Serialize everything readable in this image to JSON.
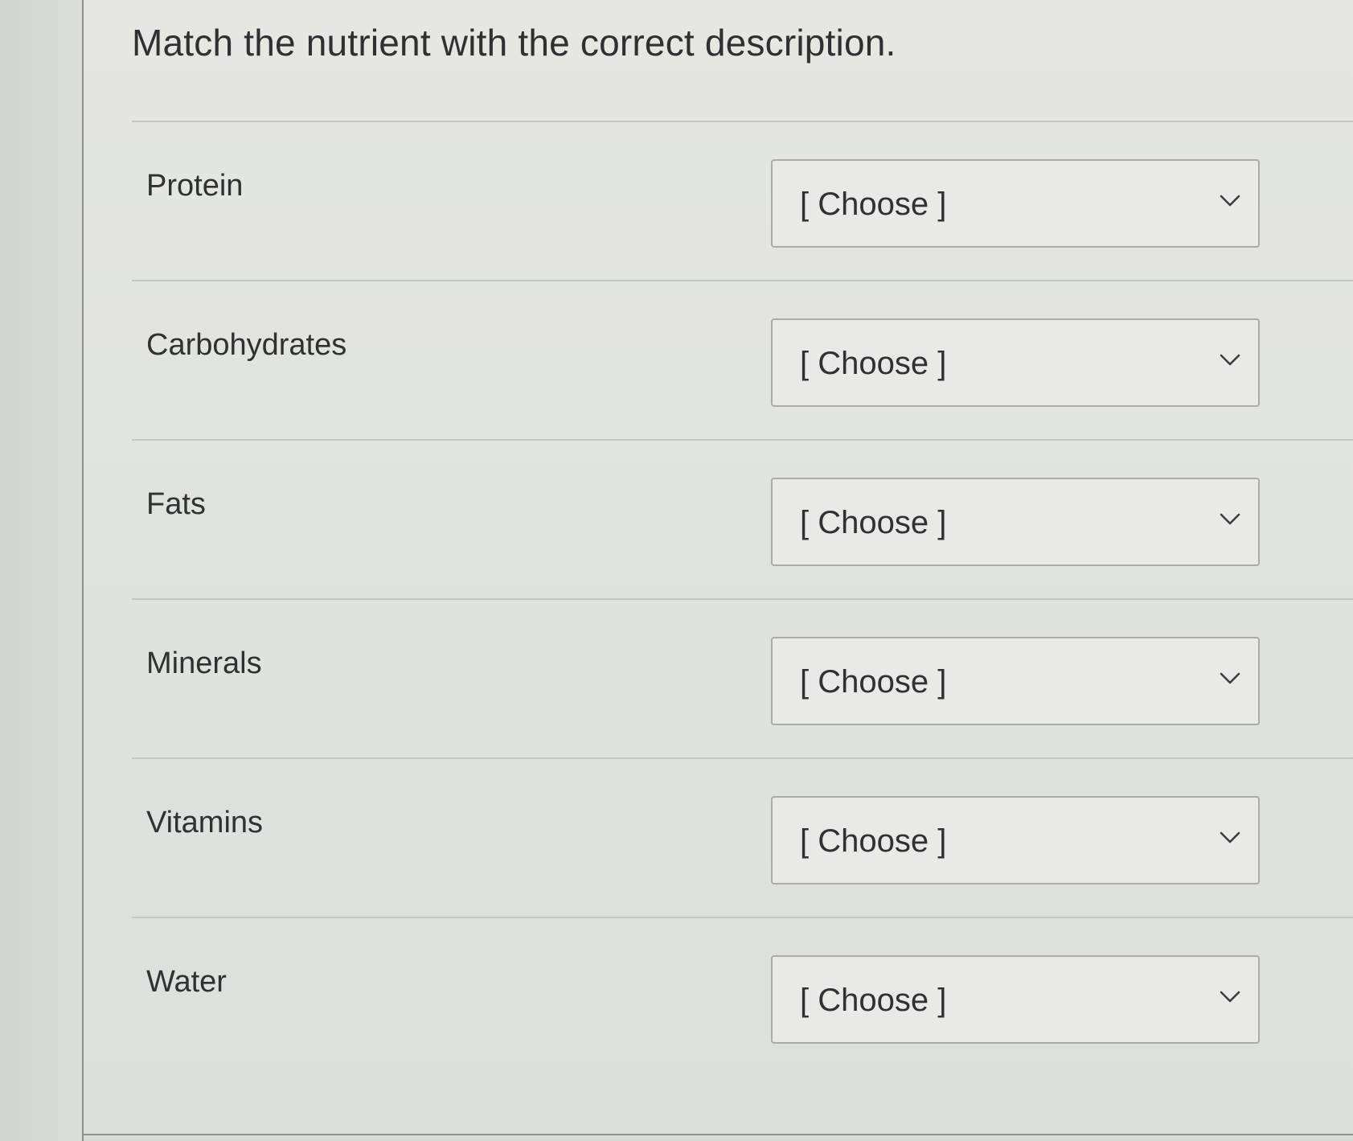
{
  "question": {
    "title": "Match the nutrient with the correct description."
  },
  "rows": [
    {
      "label": "Protein",
      "selected": "[ Choose ]"
    },
    {
      "label": "Carbohydrates",
      "selected": "[ Choose ]"
    },
    {
      "label": "Fats",
      "selected": "[ Choose ]"
    },
    {
      "label": "Minerals",
      "selected": "[ Choose ]"
    },
    {
      "label": "Vitamins",
      "selected": "[ Choose ]"
    },
    {
      "label": "Water",
      "selected": "[ Choose ]"
    }
  ],
  "icons": {
    "dropdown": "chevron-down-icon"
  },
  "colors": {
    "text": "#2f3133",
    "select_border": "#a9aca9",
    "divider": "#c5c7c4"
  }
}
